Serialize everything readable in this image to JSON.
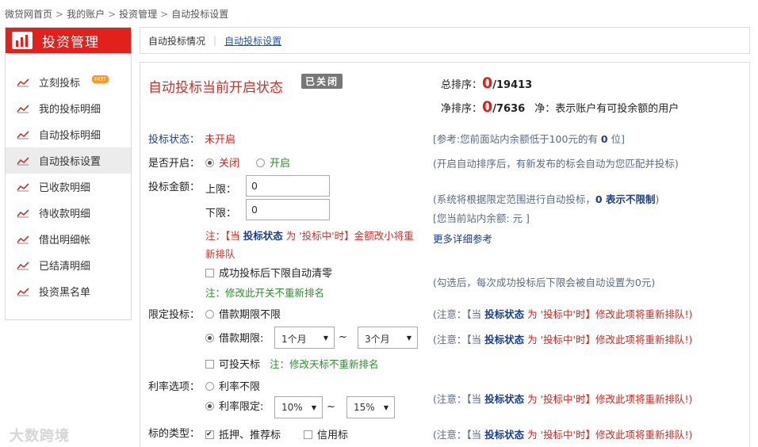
{
  "breadcrumb": [
    "微贷网首页",
    "我的账户",
    "投资管理",
    "自动投标设置"
  ],
  "breadcrumb_sep": ">",
  "sidebar": {
    "title": "投资管理",
    "hot_label": "HOT",
    "items": [
      {
        "label": "立刻投标"
      },
      {
        "label": "我的投标明细"
      },
      {
        "label": "自动投标明细"
      },
      {
        "label": "自动投标设置"
      },
      {
        "label": "已收款明细"
      },
      {
        "label": "待收款明细"
      },
      {
        "label": "借出明细帐"
      },
      {
        "label": "已结清明细"
      },
      {
        "label": "投资黑名单"
      }
    ]
  },
  "tabs": {
    "t1": "自动投标情况",
    "sep": "|",
    "t2": "自动投标设置"
  },
  "status": {
    "title": "自动投标当前开启状态",
    "badge": "已关闭"
  },
  "ranks": {
    "total_label": "总排序：",
    "total_value": "0",
    "total_count": "/19413",
    "net_label": "净排序：",
    "net_value": "0",
    "net_count": "/7636",
    "net_note": "净：表示账户有可投余额的用户"
  },
  "form": {
    "state_label": "投标状态：",
    "state_value": "未开启",
    "ref_note_pre": "[参考:您前面站内余额低于100元的有 ",
    "ref_note_num": "0",
    "ref_note_post": " 位]",
    "open_label": "是否开启：",
    "open_off": "关闭",
    "open_on": "开启",
    "open_note": "(开启自动排序后，有新发布的标会自动为您匹配并投标)",
    "amount_label": "投标金额：",
    "upper_label": "上限：",
    "upper_value": "0",
    "lower_label": "下限：",
    "lower_value": "0",
    "amount_note_1": "(系统将根据限定范围进行自动投标，",
    "amount_note_bold": "0 表示不限制",
    "amount_note_2": ")",
    "balance_note": "[您当前站内余额: 元 ]",
    "more_link": "更多详细参考",
    "warn_1": "注：【当 ",
    "warn_kw": "投标状态",
    "warn_2": " 为 '投标中'时】金额改小将重",
    "warn_3": "新排队",
    "clear_label": "成功投标后下限自动清零",
    "clear_note": "注：修改此开关不重新排名",
    "clear_help": "(勾选后，每次成功投标后下限会被自动设置为0元)",
    "limit_label": "限定投标：",
    "limit_opt1": "借款期限不限",
    "limit_opt2": "借款期限:",
    "period_from": "1个月",
    "period_to": "3个月",
    "tilde": "~",
    "sky_label": "可投天标",
    "sky_note": "注：修改天标不重新排名",
    "rate_label": "利率选项：",
    "rate_opt1": "利率不限",
    "rate_opt2": "利率限定:",
    "rate_from": "10%",
    "rate_to": "15%",
    "type_label": "标的类型：",
    "type_opt1": "抵押、推荐标",
    "type_opt2": "信用标",
    "attn_pre": "(注意：【当 ",
    "attn_kw": "投标状态",
    "attn_mid": " 为 '投标中'时】",
    "attn_post": "修改此项将重新排队!)"
  },
  "watermark": "大数跨境",
  "colors": {
    "brand_red": "#e2211c",
    "link_blue": "#1a56a8"
  }
}
